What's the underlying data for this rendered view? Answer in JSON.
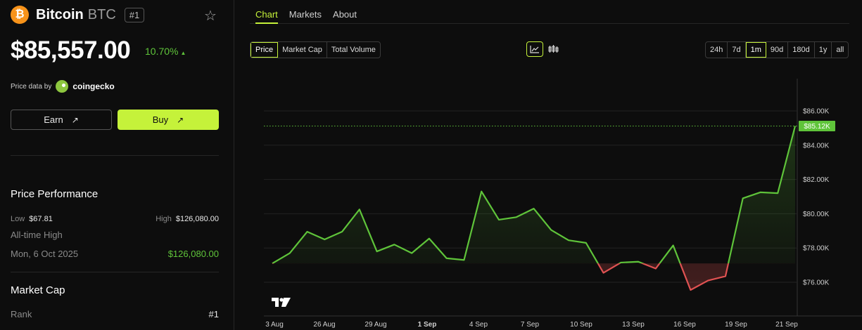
{
  "coin": {
    "logo": "₿",
    "name": "Bitcoin",
    "symbol": "BTC",
    "rank_badge": "#1",
    "price": "$85,557.00",
    "change": "10.70%",
    "change_icon": "▲",
    "star_icon": "☆"
  },
  "price_data": {
    "label": "Price data by",
    "provider": "coingecko"
  },
  "actions": {
    "earn_label": "Earn",
    "buy_label": "Buy",
    "arrow": "↗"
  },
  "performance": {
    "title": "Price Performance",
    "low_label": "Low",
    "low_value": "$67.81",
    "high_label": "High",
    "high_value": "$126,080.00",
    "ath_label": "All-time High",
    "ath_date": "Mon, 6 Oct 2025",
    "ath_value": "$126,080.00"
  },
  "market_cap": {
    "title": "Market Cap",
    "rank_label": "Rank",
    "rank_value": "#1"
  },
  "tabs": [
    "Chart",
    "Markets",
    "About"
  ],
  "metric_options": [
    "Price",
    "Market Cap",
    "Total Volume"
  ],
  "range_options": [
    "24h",
    "7d",
    "1m",
    "90d",
    "180d",
    "1y",
    "all"
  ],
  "colors": {
    "accent": "#c5f23a",
    "up": "#5fc43a",
    "down": "#e05252",
    "brand": "#f7931a"
  },
  "chart_data": {
    "type": "line",
    "x_labels": [
      "3 Aug",
      "26 Aug",
      "29 Aug",
      "1 Sep",
      "4 Sep",
      "7 Sep",
      "10 Sep",
      "13 Sep",
      "16 Sep",
      "19 Sep",
      "21 Sep"
    ],
    "y_ticks": [
      "$86.00K",
      "$84.00K",
      "$82.00K",
      "$80.00K",
      "$78.00K",
      "$76.00K"
    ],
    "ylim": [
      75000,
      87000
    ],
    "baseline": 77100,
    "current_label": "$85.12K",
    "current_value": 85120,
    "values": [
      77100,
      77700,
      78950,
      78500,
      78950,
      80250,
      77800,
      78200,
      77700,
      78550,
      77400,
      77300,
      81300,
      79650,
      79800,
      80300,
      79050,
      78450,
      78300,
      76550,
      77150,
      77200,
      76800,
      78150,
      75550,
      76100,
      76350,
      80900,
      81250,
      81200,
      85120
    ],
    "grid": true
  }
}
